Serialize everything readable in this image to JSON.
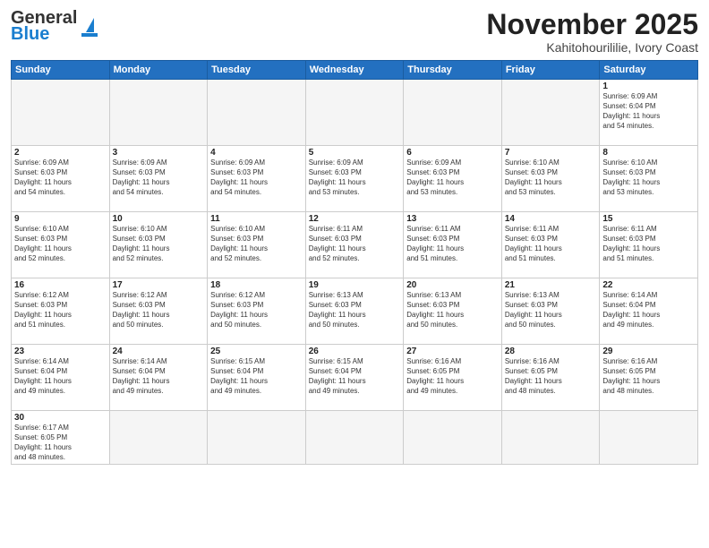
{
  "header": {
    "logo_general": "General",
    "logo_blue": "Blue",
    "month": "November 2025",
    "location": "Kahitohourililie, Ivory Coast"
  },
  "weekdays": [
    "Sunday",
    "Monday",
    "Tuesday",
    "Wednesday",
    "Thursday",
    "Friday",
    "Saturday"
  ],
  "weeks": [
    [
      {
        "day": "",
        "info": ""
      },
      {
        "day": "",
        "info": ""
      },
      {
        "day": "",
        "info": ""
      },
      {
        "day": "",
        "info": ""
      },
      {
        "day": "",
        "info": ""
      },
      {
        "day": "",
        "info": ""
      },
      {
        "day": "1",
        "info": "Sunrise: 6:09 AM\nSunset: 6:04 PM\nDaylight: 11 hours\nand 54 minutes."
      }
    ],
    [
      {
        "day": "2",
        "info": "Sunrise: 6:09 AM\nSunset: 6:03 PM\nDaylight: 11 hours\nand 54 minutes."
      },
      {
        "day": "3",
        "info": "Sunrise: 6:09 AM\nSunset: 6:03 PM\nDaylight: 11 hours\nand 54 minutes."
      },
      {
        "day": "4",
        "info": "Sunrise: 6:09 AM\nSunset: 6:03 PM\nDaylight: 11 hours\nand 54 minutes."
      },
      {
        "day": "5",
        "info": "Sunrise: 6:09 AM\nSunset: 6:03 PM\nDaylight: 11 hours\nand 53 minutes."
      },
      {
        "day": "6",
        "info": "Sunrise: 6:09 AM\nSunset: 6:03 PM\nDaylight: 11 hours\nand 53 minutes."
      },
      {
        "day": "7",
        "info": "Sunrise: 6:10 AM\nSunset: 6:03 PM\nDaylight: 11 hours\nand 53 minutes."
      },
      {
        "day": "8",
        "info": "Sunrise: 6:10 AM\nSunset: 6:03 PM\nDaylight: 11 hours\nand 53 minutes."
      }
    ],
    [
      {
        "day": "9",
        "info": "Sunrise: 6:10 AM\nSunset: 6:03 PM\nDaylight: 11 hours\nand 52 minutes."
      },
      {
        "day": "10",
        "info": "Sunrise: 6:10 AM\nSunset: 6:03 PM\nDaylight: 11 hours\nand 52 minutes."
      },
      {
        "day": "11",
        "info": "Sunrise: 6:10 AM\nSunset: 6:03 PM\nDaylight: 11 hours\nand 52 minutes."
      },
      {
        "day": "12",
        "info": "Sunrise: 6:11 AM\nSunset: 6:03 PM\nDaylight: 11 hours\nand 52 minutes."
      },
      {
        "day": "13",
        "info": "Sunrise: 6:11 AM\nSunset: 6:03 PM\nDaylight: 11 hours\nand 51 minutes."
      },
      {
        "day": "14",
        "info": "Sunrise: 6:11 AM\nSunset: 6:03 PM\nDaylight: 11 hours\nand 51 minutes."
      },
      {
        "day": "15",
        "info": "Sunrise: 6:11 AM\nSunset: 6:03 PM\nDaylight: 11 hours\nand 51 minutes."
      }
    ],
    [
      {
        "day": "16",
        "info": "Sunrise: 6:12 AM\nSunset: 6:03 PM\nDaylight: 11 hours\nand 51 minutes."
      },
      {
        "day": "17",
        "info": "Sunrise: 6:12 AM\nSunset: 6:03 PM\nDaylight: 11 hours\nand 50 minutes."
      },
      {
        "day": "18",
        "info": "Sunrise: 6:12 AM\nSunset: 6:03 PM\nDaylight: 11 hours\nand 50 minutes."
      },
      {
        "day": "19",
        "info": "Sunrise: 6:13 AM\nSunset: 6:03 PM\nDaylight: 11 hours\nand 50 minutes."
      },
      {
        "day": "20",
        "info": "Sunrise: 6:13 AM\nSunset: 6:03 PM\nDaylight: 11 hours\nand 50 minutes."
      },
      {
        "day": "21",
        "info": "Sunrise: 6:13 AM\nSunset: 6:03 PM\nDaylight: 11 hours\nand 50 minutes."
      },
      {
        "day": "22",
        "info": "Sunrise: 6:14 AM\nSunset: 6:04 PM\nDaylight: 11 hours\nand 49 minutes."
      }
    ],
    [
      {
        "day": "23",
        "info": "Sunrise: 6:14 AM\nSunset: 6:04 PM\nDaylight: 11 hours\nand 49 minutes."
      },
      {
        "day": "24",
        "info": "Sunrise: 6:14 AM\nSunset: 6:04 PM\nDaylight: 11 hours\nand 49 minutes."
      },
      {
        "day": "25",
        "info": "Sunrise: 6:15 AM\nSunset: 6:04 PM\nDaylight: 11 hours\nand 49 minutes."
      },
      {
        "day": "26",
        "info": "Sunrise: 6:15 AM\nSunset: 6:04 PM\nDaylight: 11 hours\nand 49 minutes."
      },
      {
        "day": "27",
        "info": "Sunrise: 6:16 AM\nSunset: 6:05 PM\nDaylight: 11 hours\nand 49 minutes."
      },
      {
        "day": "28",
        "info": "Sunrise: 6:16 AM\nSunset: 6:05 PM\nDaylight: 11 hours\nand 48 minutes."
      },
      {
        "day": "29",
        "info": "Sunrise: 6:16 AM\nSunset: 6:05 PM\nDaylight: 11 hours\nand 48 minutes."
      }
    ],
    [
      {
        "day": "30",
        "info": "Sunrise: 6:17 AM\nSunset: 6:05 PM\nDaylight: 11 hours\nand 48 minutes."
      },
      {
        "day": "",
        "info": ""
      },
      {
        "day": "",
        "info": ""
      },
      {
        "day": "",
        "info": ""
      },
      {
        "day": "",
        "info": ""
      },
      {
        "day": "",
        "info": ""
      },
      {
        "day": "",
        "info": ""
      }
    ]
  ]
}
